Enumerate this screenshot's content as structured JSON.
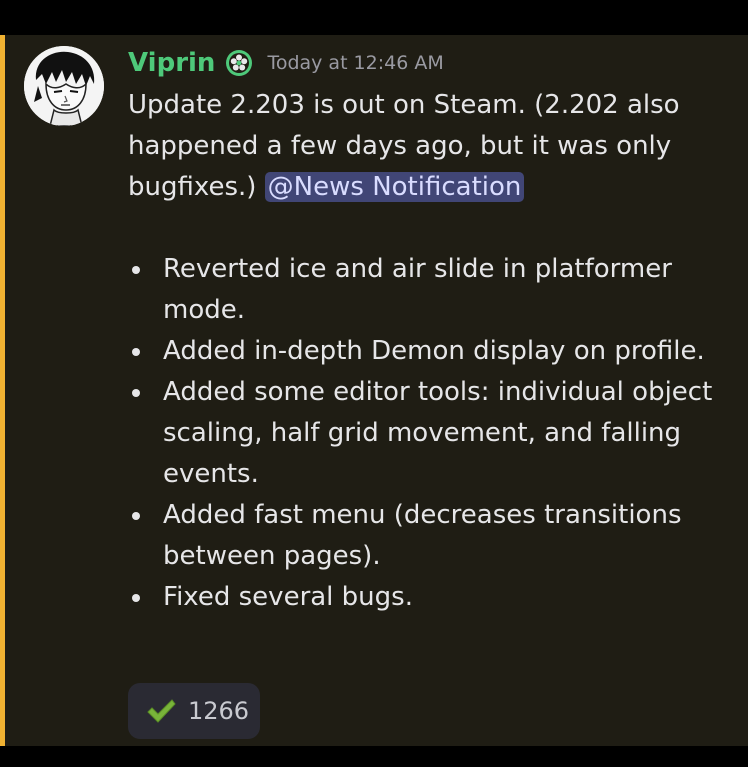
{
  "message": {
    "author": "Viprin",
    "timestamp": "Today at 12:46 AM",
    "intro_text": "Update 2.203 is out on Steam. (2.202 also happened a few days ago, but it was only bugfixes.) ",
    "mention": "@News Notification",
    "bullets": [
      "Reverted ice and air slide in platformer mode.",
      "Added in-depth Demon display on profile.",
      "Added some editor tools: individual object scaling, half grid movement, and falling events.",
      "Added fast menu (decreases transitions between pages).",
      "Fixed several bugs."
    ],
    "reaction": {
      "icon": "check-mark-icon",
      "count": "1266"
    }
  },
  "colors": {
    "background": "#1f1d14",
    "highlight_bar": "#f0b232",
    "username": "#4ec97a",
    "mention_bg": "#414676",
    "text": "#e6e6e8",
    "timestamp": "#9a9aa2"
  }
}
